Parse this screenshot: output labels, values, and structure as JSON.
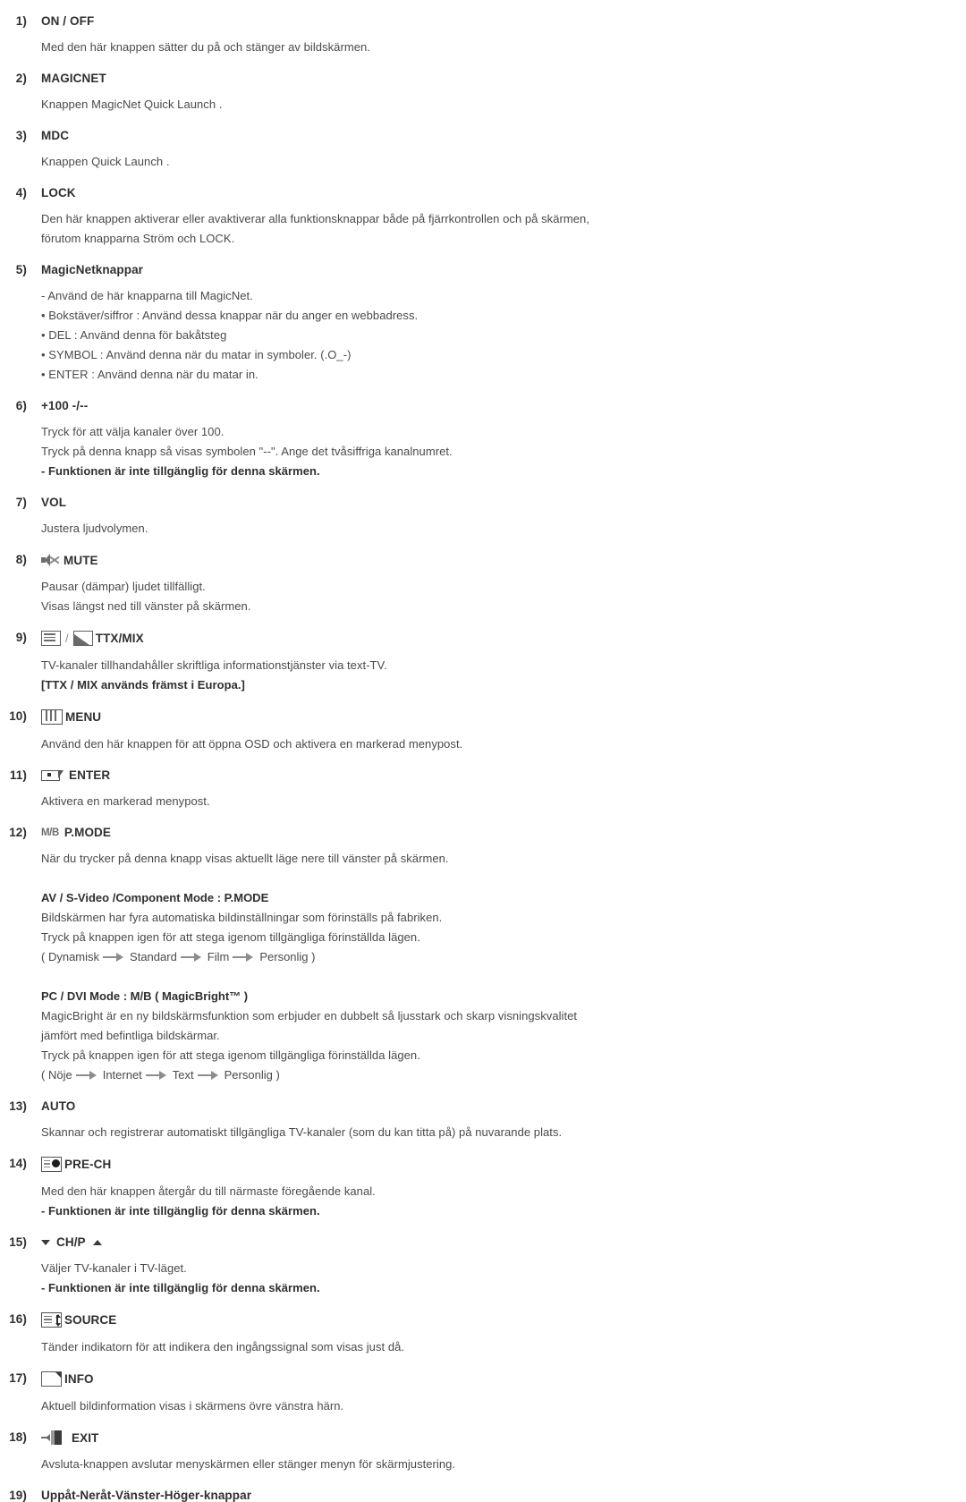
{
  "document": {
    "language": "sv",
    "entries": [
      {
        "num": "1)",
        "title": "ON / OFF",
        "icon": null,
        "lines": [
          {
            "text": "Med den här knappen sätter du på och stänger av bildskärmen.",
            "bold": false
          }
        ]
      },
      {
        "num": "2)",
        "title": "MAGICNET",
        "icon": null,
        "lines": [
          {
            "text": "Knappen MagicNet Quick Launch .",
            "bold": false
          }
        ]
      },
      {
        "num": "3)",
        "title": "MDC",
        "icon": null,
        "lines": [
          {
            "text": "Knappen Quick Launch .",
            "bold": false
          }
        ]
      },
      {
        "num": "4)",
        "title": "LOCK",
        "icon": null,
        "lines": [
          {
            "text": "Den här knappen aktiverar eller avaktiverar alla funktionsknappar både på fjärrkontrollen och på skärmen,",
            "bold": false
          },
          {
            "text": "förutom knapparna Ström och LOCK.",
            "bold": false
          }
        ]
      },
      {
        "num": "5)",
        "title": "MagicNetknappar",
        "icon": null,
        "lines": [
          {
            "text": "- Använd de här knapparna till MagicNet.",
            "bold": false
          },
          {
            "text": "• Bokstäver/siffror : Använd dessa knappar när du anger en webbadress.",
            "bold": false
          },
          {
            "text": "• DEL : Använd denna för bakåtsteg",
            "bold": false
          },
          {
            "text": "• SYMBOL : Använd denna när du matar in symboler. (.O_-)",
            "bold": false
          },
          {
            "text": "• ENTER : Använd denna när du matar in.",
            "bold": false
          }
        ]
      },
      {
        "num": "6)",
        "title": "+100 -/--",
        "icon": null,
        "lines": [
          {
            "text": "Tryck för att välja kanaler över 100.",
            "bold": false
          },
          {
            "text": "Tryck på denna knapp så visas symbolen \"--\". Ange det tvåsiffriga kanalnumret.",
            "bold": false
          },
          {
            "text": "- Funktionen är inte tillgänglig för denna skärmen.",
            "bold": true
          }
        ]
      },
      {
        "num": "7)",
        "title": "VOL",
        "icon": null,
        "lines": [
          {
            "text": "Justera ljudvolymen.",
            "bold": false
          }
        ]
      },
      {
        "num": "8)",
        "title": "MUTE",
        "icon": "mute-icon",
        "lines": [
          {
            "text": "Pausar (dämpar) ljudet tillfälligt.",
            "bold": false
          },
          {
            "text": "Visas längst ned till vänster på skärmen.",
            "bold": false
          }
        ]
      },
      {
        "num": "9)",
        "title": "TTX/MIX",
        "icon": "ttx-mix-icon",
        "lines": [
          {
            "text": "TV-kanaler tillhandahåller skriftliga informationstjänster via text-TV.",
            "bold": false
          },
          {
            "text": "[TTX / MIX används främst i Europa.]",
            "bold": true
          }
        ]
      },
      {
        "num": "10)",
        "title": "MENU",
        "icon": "menu-icon",
        "lines": [
          {
            "text": "Använd den här knappen för att öppna OSD och aktivera en markerad menypost.",
            "bold": false
          }
        ]
      },
      {
        "num": "11)",
        "title": "ENTER",
        "icon": "enter-icon",
        "lines": [
          {
            "text": "Aktivera en markerad menypost.",
            "bold": false
          }
        ]
      },
      {
        "num": "12)",
        "title": "P.MODE",
        "icon": "mb-icon",
        "icon_label": "M/B",
        "lines": [
          {
            "text": "När du trycker på denna knapp visas aktuellt läge nere till vänster på skärmen.",
            "bold": false
          }
        ],
        "subsections": [
          {
            "heading": "AV / S-Video /Component Mode : P.MODE",
            "lines": [
              "Bildskärmen har fyra automatiska bildinställningar som förinställs på fabriken.",
              "Tryck på knappen igen för att stega igenom tillgängliga förinställda lägen."
            ],
            "sequence_open": "( ",
            "sequence": [
              "Dynamisk",
              "Standard",
              "Film",
              "Personlig"
            ],
            "sequence_close": " )"
          },
          {
            "heading": "PC / DVI Mode : M/B ( MagicBright™ )",
            "lines": [
              "MagicBright är en ny bildskärmsfunktion som erbjuder en dubbelt så ljusstark och skarp visningskvalitet",
              "jämfört med befintliga bildskärmar.",
              "Tryck på knappen igen för att stega igenom tillgängliga förinställda lägen."
            ],
            "sequence_open": "( ",
            "sequence": [
              "Nöje",
              "Internet",
              "Text",
              "Personlig"
            ],
            "sequence_close": " )"
          }
        ]
      },
      {
        "num": "13)",
        "title": "AUTO",
        "icon": null,
        "lines": [
          {
            "text": "Skannar och registrerar automatiskt tillgängliga TV-kanaler (som du kan titta på) på nuvarande plats.",
            "bold": false
          }
        ]
      },
      {
        "num": "14)",
        "title": "PRE-CH",
        "icon": "pre-ch-icon",
        "lines": [
          {
            "text": "Med den här knappen återgår du till närmaste föregående kanal.",
            "bold": false
          },
          {
            "text": "- Funktionen är inte tillgänglig för denna skärmen.",
            "bold": true
          }
        ]
      },
      {
        "num": "15)",
        "title": "CH/P",
        "icon": "ch-p-icon",
        "lines": [
          {
            "text": "Väljer TV-kanaler i TV-läget.",
            "bold": false
          },
          {
            "text": "- Funktionen är inte tillgänglig för denna skärmen.",
            "bold": true
          }
        ]
      },
      {
        "num": "16)",
        "title": "SOURCE",
        "icon": "source-icon",
        "lines": [
          {
            "text": "Tänder indikatorn för att indikera den ingångssignal som visas just då.",
            "bold": false
          }
        ]
      },
      {
        "num": "17)",
        "title": "INFO",
        "icon": "info-icon",
        "lines": [
          {
            "text": "Aktuell bildinformation visas i skärmens övre vänstra härn.",
            "bold": false
          }
        ]
      },
      {
        "num": "18)",
        "title": "EXIT",
        "icon": "exit-icon",
        "lines": [
          {
            "text": "Avsluta-knappen avslutar menyskärmen eller stänger menyn för skärmjustering.",
            "bold": false
          }
        ]
      },
      {
        "num": "19)",
        "title": "Uppåt-Neråt-Vänster-Höger-knappar",
        "icon": null,
        "lines": []
      }
    ]
  }
}
